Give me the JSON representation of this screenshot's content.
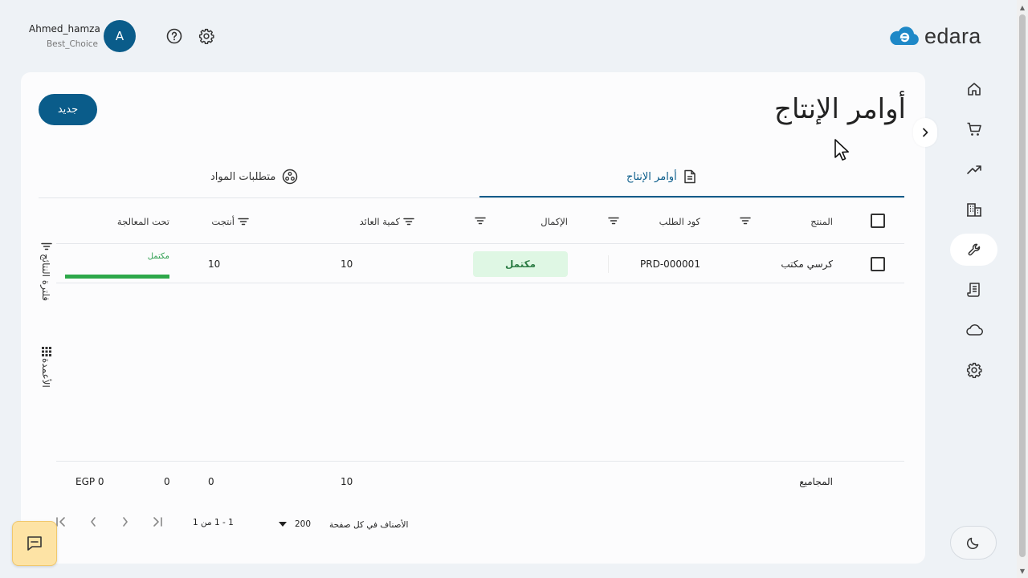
{
  "user": {
    "name": "Ahmed_hamza",
    "org": "Best_Choice",
    "avatar_letter": "A"
  },
  "header_icons": [
    "help-icon",
    "settings-gear-icon"
  ],
  "logo": {
    "text": "edara",
    "brand_color": "#1e88c7"
  },
  "sidebar": {
    "items": [
      {
        "name": "home-icon"
      },
      {
        "name": "shopping-cart-icon"
      },
      {
        "name": "trending-up-icon"
      },
      {
        "name": "buildings-icon"
      },
      {
        "name": "wrench-icon",
        "active": true
      },
      {
        "name": "receipt-icon"
      },
      {
        "name": "cloud-icon"
      },
      {
        "name": "settings-gear-icon"
      }
    ],
    "theme_toggle": "moon-icon"
  },
  "page": {
    "title": "أوامر الإنتاج",
    "new_button": "جديد"
  },
  "tabs": [
    {
      "label": "أوامر الإنتاج",
      "icon": "document-icon",
      "active": true
    },
    {
      "label": "متطلبات المواد",
      "icon": "materials-icon",
      "active": false
    }
  ],
  "table": {
    "headers": {
      "product": "المنتج",
      "order_code": "كود الطلب",
      "completion": "الإكمال",
      "return_qty": "كمية العائد",
      "produced": "أنتجت",
      "in_process": "تحت المعالجة"
    },
    "rows": [
      {
        "product": "كرسي مكتب",
        "order_code": "PRD-000001",
        "completion": "مكتمل",
        "return_qty": "10",
        "produced": "10",
        "in_process_label": "مكتمل",
        "progress": 1.0
      }
    ]
  },
  "side_panel": {
    "filter_label": "فلترة النتائج",
    "columns_label": "الأعمدة"
  },
  "totals": {
    "label": "المجاميع",
    "return_qty": "10",
    "produced": "0",
    "in_process": "0",
    "amount": "EGP 0"
  },
  "pagination": {
    "per_page_label": "الأصناف في كل صفحة",
    "per_page_value": "200",
    "range": "1 - 1 من 1"
  },
  "colors": {
    "primary": "#0a5c8a",
    "success_bg": "#dff7e4",
    "success_text": "#2e7d46",
    "progress": "#2ea84a",
    "chat_bg": "#fde3a5"
  }
}
